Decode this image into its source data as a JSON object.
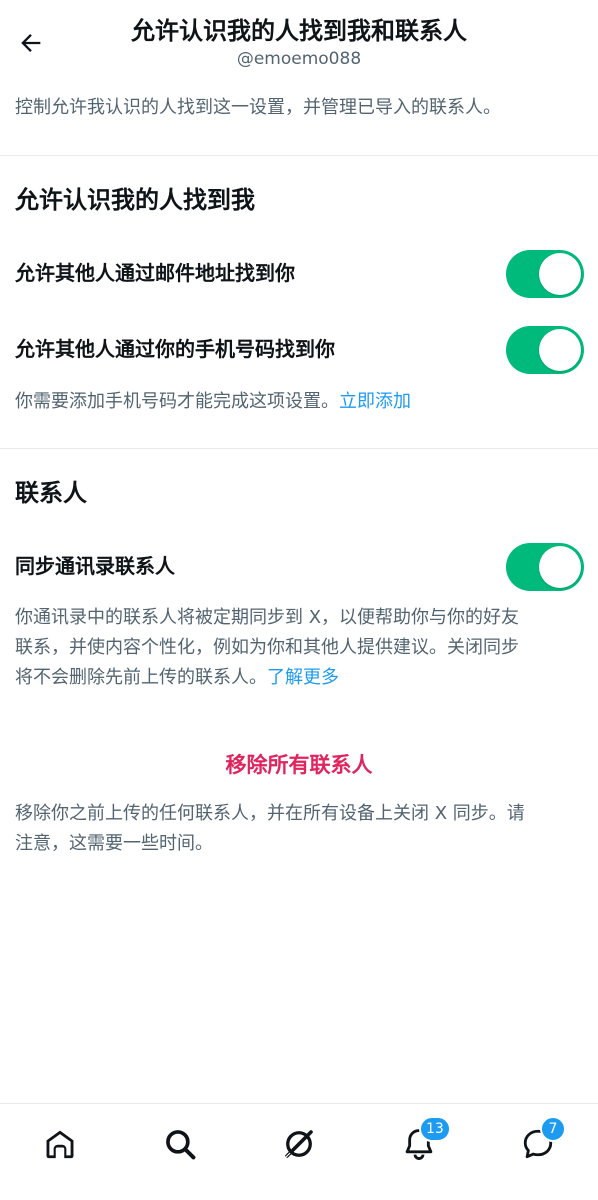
{
  "header": {
    "title": "允许认识我的人找到我和联系人",
    "username": "@emoemo088"
  },
  "intro": "控制允许我认识的人找到这一设置，并管理已导入的联系人。",
  "discoverability": {
    "title": "允许认识我的人找到我",
    "email_label": "允许其他人通过邮件地址找到你",
    "email_enabled": true,
    "phone_label": "允许其他人通过你的手机号码找到你",
    "phone_enabled": true,
    "phone_note": "你需要添加手机号码才能完成这项设置。",
    "phone_link": "立即添加"
  },
  "contacts": {
    "title": "联系人",
    "sync_label": "同步通讯录联系人",
    "sync_enabled": true,
    "sync_note_line1": "你通讯录中的联系人将被定期同步到 X，以便帮助你与你的好友",
    "sync_note_line2": "联系，并使内容个性化，例如为你和其他人提供建议。关闭同步",
    "sync_note_line3": "将不会删除先前上传的联系人。",
    "sync_link": "了解更多",
    "remove_label": "移除所有联系人",
    "remove_note_line1": "移除你之前上传的任何联系人，并在所有设备上关闭 X 同步。请",
    "remove_note_line2": "注意，这需要一些时间。"
  },
  "nav": {
    "items": [
      {
        "icon": "home-icon"
      },
      {
        "icon": "search-icon"
      },
      {
        "icon": "grok-icon"
      },
      {
        "icon": "bell-icon",
        "badge": "13"
      },
      {
        "icon": "messages-icon",
        "badge": "7"
      }
    ]
  },
  "colors": {
    "accent": "#1d9bf0",
    "toggle_on": "#00ba7c",
    "danger": "#e0245e"
  }
}
